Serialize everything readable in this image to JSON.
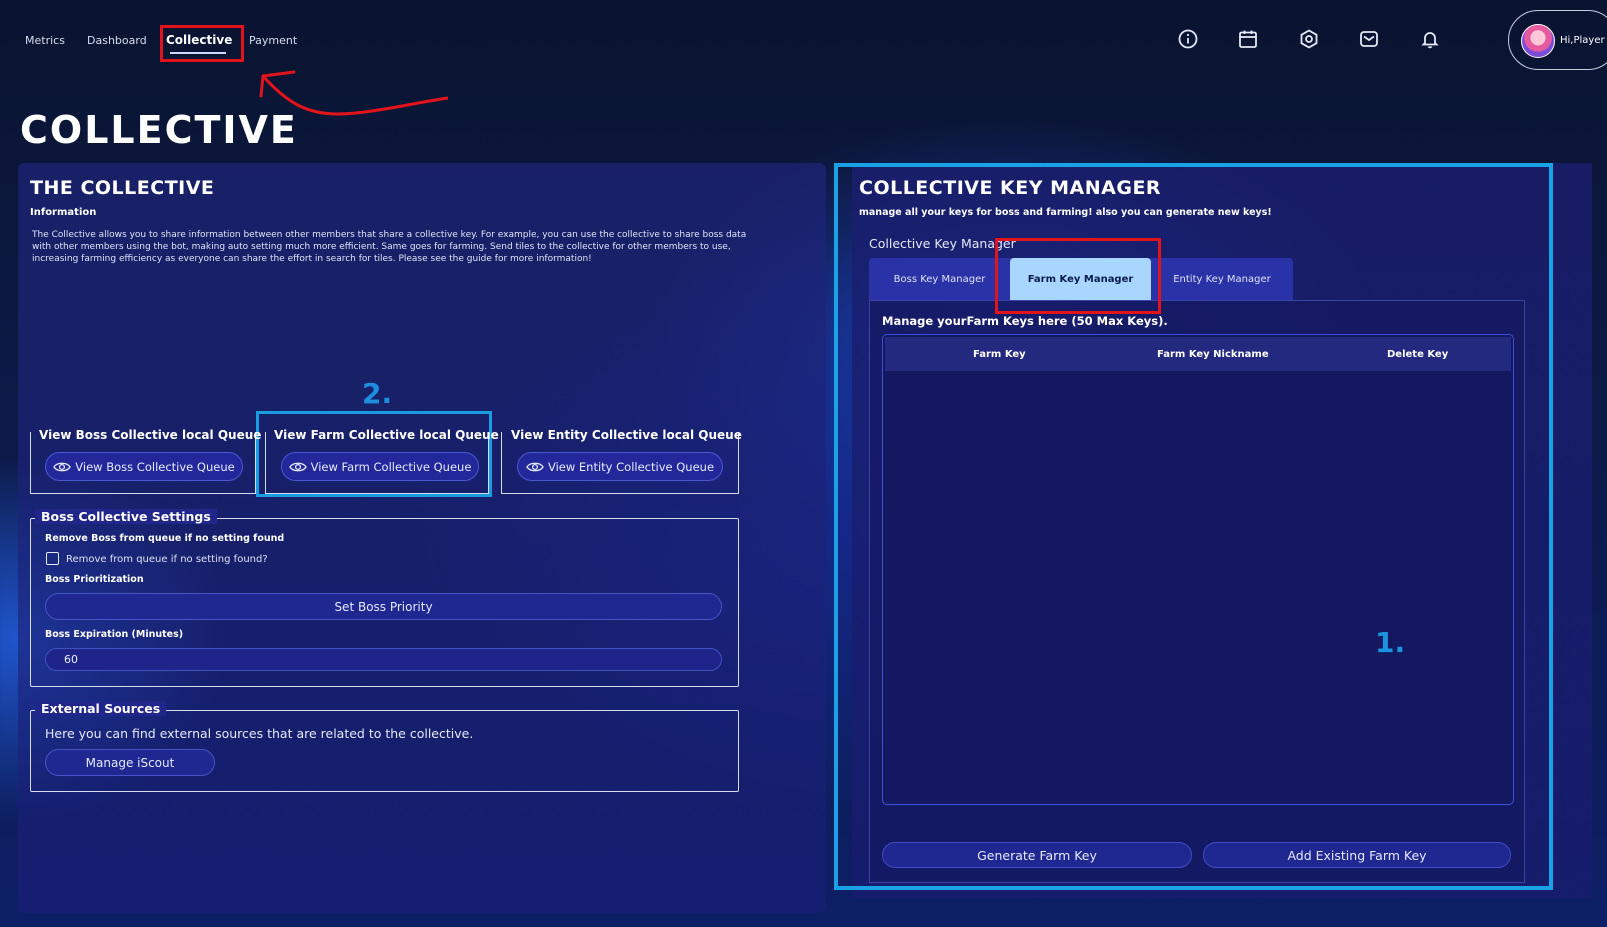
{
  "nav": {
    "links": [
      "Metrics",
      "Dashboard",
      "Collective",
      "Payment"
    ],
    "active": "Collective"
  },
  "profile": {
    "greeting": "Hi,Player"
  },
  "page": {
    "title": "COLLECTIVE"
  },
  "left": {
    "title": "THE COLLECTIVE",
    "info_label": "Information",
    "info_text": "The Collective allows you to share information between other members that share a collective key. For example, you can use the collective to share boss data with other members using the bot, making auto setting much more efficient. Same goes for farming. Send tiles to the collective for other members to use, increasing farming efficiency as everyone can share the effort in search for tiles. Please see the guide for more information!",
    "annotation_2": "2.",
    "queues": [
      {
        "title": "View Boss Collective  local Queue",
        "button": "View Boss Collective Queue"
      },
      {
        "title": "View Farm Collective  local Queue",
        "button": "View Farm Collective Queue"
      },
      {
        "title": "View Entity Collective  local Queue",
        "button": "View Entity Collective Queue"
      }
    ],
    "boss_settings": {
      "legend": "Boss Collective Settings",
      "remove_label": "Remove Boss from queue if no setting found",
      "remove_checkbox_label": "Remove from queue if no setting found?",
      "remove_checked": false,
      "priority_label": "Boss Prioritization",
      "priority_button": "Set Boss Priority",
      "expiration_label": "Boss Expiration (Minutes)",
      "expiration_value": "60"
    },
    "external": {
      "legend": "External Sources",
      "text": "Here you can find external sources that are related to the collective.",
      "button": "Manage iScout"
    }
  },
  "right": {
    "title": "COLLECTIVE KEY MANAGER",
    "subtitle": "manage all your keys for boss and farming! also you can generate new keys!",
    "manager_label": "Collective Key Manager",
    "tabs": [
      "Boss Key Manager",
      "Farm Key Manager",
      "Entity Key Manager"
    ],
    "active_tab": "Farm Key Manager",
    "manage_text": "Manage yourFarm Keys here (50 Max Keys).",
    "table_headers": [
      "Farm Key",
      "Farm Key Nickname",
      "Delete Key"
    ],
    "annotation_1": "1.",
    "buttons": {
      "generate": "Generate Farm Key",
      "add_existing": "Add Existing Farm Key"
    }
  },
  "colors": {
    "annotation_red": "#e3131b",
    "annotation_blue": "#1aa2e6",
    "active_tab_bg": "#a9d6ff"
  },
  "icons": [
    "info-icon",
    "calendar-icon",
    "settings-hexagon-icon",
    "mail-icon",
    "bell-icon",
    "eye-icon"
  ]
}
